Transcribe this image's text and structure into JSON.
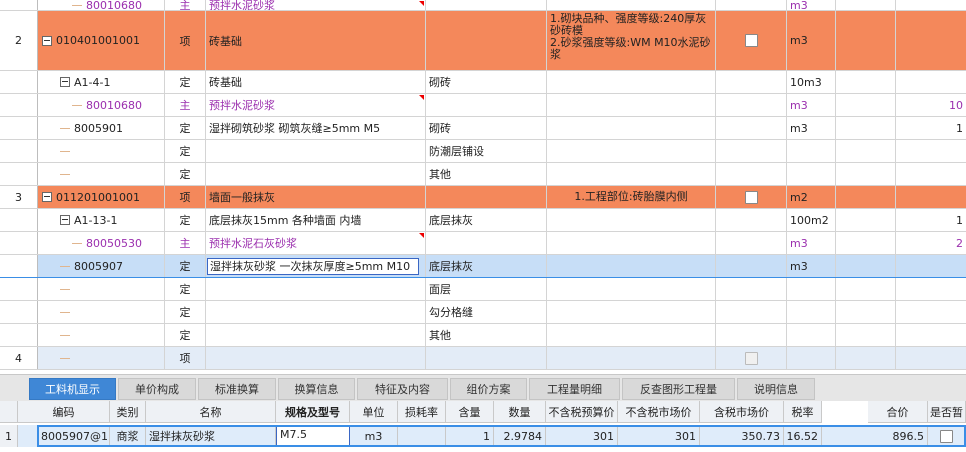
{
  "rows": [
    {
      "kind": "top-partial",
      "code": "80010680",
      "type": "主",
      "name": "预拌水泥砂浆",
      "unit": "m3"
    },
    {
      "kind": "orange",
      "num": "2",
      "code": "010401001001",
      "type": "项",
      "name": "砖基础",
      "work": "",
      "feature": "1.砌块品种、强度等级:240厚灰砂砖模\n2.砂浆强度等级:WM M10水泥砂浆",
      "unit": "m3"
    },
    {
      "kind": "quota",
      "code": "A1-4-1",
      "type": "定",
      "name": "砖基础",
      "work": "砌砖",
      "unit": "10m3",
      "e2": ""
    },
    {
      "kind": "material",
      "code": "80010680",
      "type": "主",
      "name": "预拌水泥砂浆",
      "work": "",
      "unit": "m3",
      "e2": "10"
    },
    {
      "kind": "sub",
      "code": "8005901",
      "type": "定",
      "name": "湿拌砌筑砂浆 砌筑灰缝≥5mm M5",
      "work": "砌砖",
      "unit": "m3",
      "e2": "1"
    },
    {
      "kind": "empty",
      "type": "定",
      "work": "防潮层铺设"
    },
    {
      "kind": "empty",
      "type": "定",
      "work": "其他"
    },
    {
      "kind": "orange",
      "num": "3",
      "code": "011201001001",
      "type": "项",
      "name": "墙面一般抹灰",
      "work": "",
      "feature": "1.工程部位:砖胎膜内侧",
      "unit": "m2"
    },
    {
      "kind": "quota",
      "code": "A1-13-1",
      "type": "定",
      "name": "底层抹灰15mm 各种墙面 内墙",
      "work": "底层抹灰",
      "unit": "100m2",
      "e2": "1"
    },
    {
      "kind": "material",
      "code": "80050530",
      "type": "主",
      "name": "预拌水泥石灰砂浆",
      "work": "",
      "unit": "m3",
      "e2": "2"
    },
    {
      "kind": "selected",
      "code": "8005907",
      "type": "定",
      "name": "湿拌抹灰砂浆 一次抹灰厚度≥5mm M10",
      "work": "底层抹灰",
      "unit": "m3",
      "e2": ""
    },
    {
      "kind": "empty",
      "type": "定",
      "work": "面层"
    },
    {
      "kind": "empty",
      "type": "定",
      "work": "勾分格缝"
    },
    {
      "kind": "empty",
      "type": "定",
      "work": "其他"
    },
    {
      "kind": "last",
      "num": "4",
      "type": "项"
    }
  ],
  "tabs": [
    "工料机显示",
    "单价构成",
    "标准换算",
    "换算信息",
    "特征及内容",
    "组价方案",
    "工程量明细",
    "反查图形工程量",
    "说明信息"
  ],
  "bottom_headers": [
    "编码",
    "类别",
    "名称",
    "规格及型号",
    "单位",
    "损耗率",
    "含量",
    "数量",
    "不含税预算价",
    "不含税市场价",
    "含税市场价",
    "税率",
    "合价",
    "是否暂"
  ],
  "bottom_row": {
    "num": "1",
    "code": "8005907@1",
    "type": "商浆",
    "name": "湿拌抹灰砂浆",
    "spec": "M7.5",
    "unit": "m3",
    "loss": "",
    "content": "1",
    "qty": "2.9784",
    "price1": "301",
    "price2": "301",
    "price3": "350.73",
    "tax": "16.52",
    "total": "896.5"
  },
  "colors": {
    "orange": "#f4885b",
    "selected": "#c7def7",
    "tab_active": "#3f87d6",
    "material_text": "#9b2fae"
  }
}
